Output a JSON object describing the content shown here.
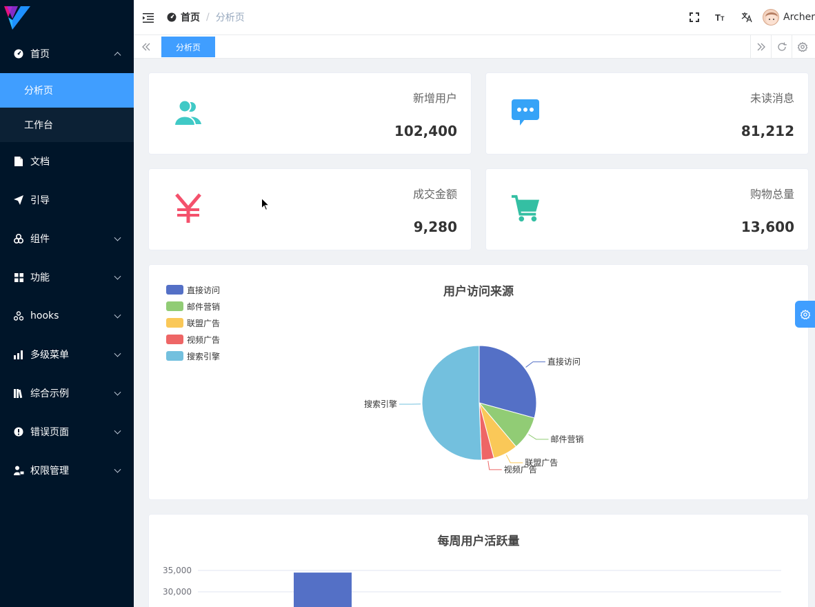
{
  "sidebar": {
    "menu": [
      {
        "label": "首页",
        "icon": "dashboard-icon",
        "expanded": true,
        "children": [
          {
            "label": "分析页",
            "active": true
          },
          {
            "label": "工作台",
            "active": false
          }
        ]
      },
      {
        "label": "文档",
        "icon": "document-icon"
      },
      {
        "label": "引导",
        "icon": "send-icon"
      },
      {
        "label": "组件",
        "icon": "component-icon"
      },
      {
        "label": "功能",
        "icon": "grid-icon"
      },
      {
        "label": "hooks",
        "icon": "hooks-icon"
      },
      {
        "label": "多级菜单",
        "icon": "bar-chart-icon"
      },
      {
        "label": "综合示例",
        "icon": "books-icon"
      },
      {
        "label": "错误页面",
        "icon": "error-icon"
      },
      {
        "label": "权限管理",
        "icon": "user-lock-icon"
      }
    ]
  },
  "header": {
    "breadcrumb_home": "首页",
    "breadcrumb_sep": "/",
    "breadcrumb_current": "分析页",
    "username": "Archer"
  },
  "tags": {
    "active": "分析页"
  },
  "stats": [
    {
      "label": "新增用户",
      "value": "102,400",
      "icon": "users-icon",
      "color": "#40c9c6"
    },
    {
      "label": "未读消息",
      "value": "81,212",
      "icon": "message-icon",
      "color": "#36a3f7"
    },
    {
      "label": "成交金额",
      "value": "9,280",
      "icon": "yen-icon",
      "color": "#f4516c"
    },
    {
      "label": "购物总量",
      "value": "13,600",
      "icon": "cart-icon",
      "color": "#34bfa3"
    }
  ],
  "pie": {
    "title": "用户访问来源"
  },
  "bar": {
    "title": "每周用户活跃量"
  },
  "chart_data": [
    {
      "type": "pie",
      "title": "用户访问来源",
      "legend_position": "top-left",
      "labels": [
        "直接访问",
        "邮件营销",
        "联盟广告",
        "视频广告",
        "搜索引擎"
      ],
      "values": [
        335,
        110,
        80,
        40,
        580
      ],
      "colors": [
        "#5470c6",
        "#91cc75",
        "#fac858",
        "#ee6666",
        "#73c0de"
      ]
    },
    {
      "type": "bar",
      "title": "每周用户活跃量",
      "y_ticks": [
        "35,000",
        "30,000"
      ],
      "ylim_visible": [
        30000,
        35000
      ],
      "values_visible": [
        34500
      ],
      "color": "#5470c6",
      "grid": true
    }
  ]
}
